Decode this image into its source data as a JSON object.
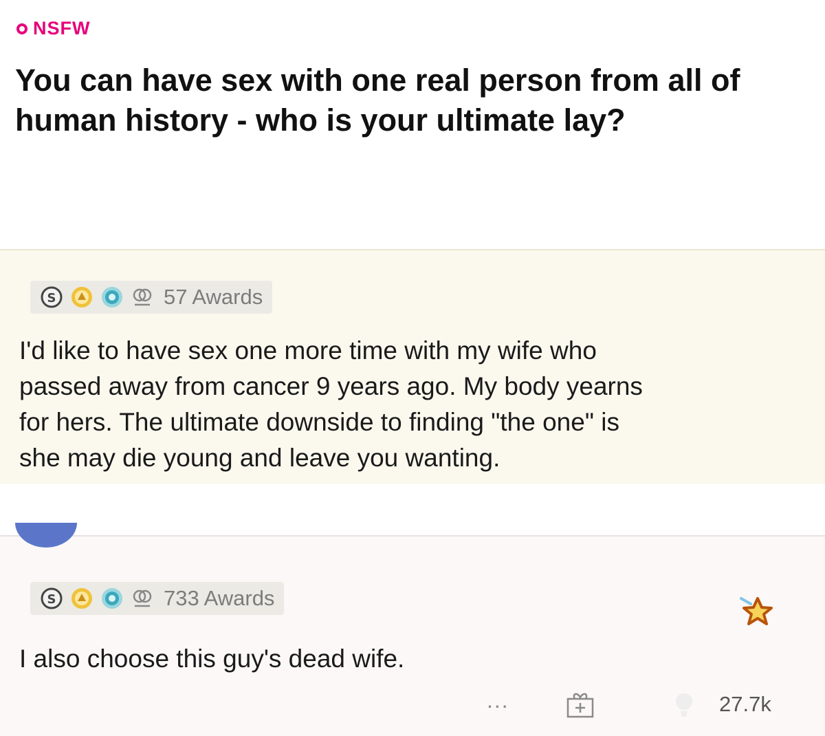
{
  "post": {
    "nsfw_label": "NSFW",
    "title": "You can have sex with one real person from all of human history - who is your ultimate lay?"
  },
  "comments": [
    {
      "awards_label": "57 Awards",
      "body_lines": [
        "I'd like to have sex one more time with my wife who",
        "passed away from cancer 9 years ago.  My body yearns",
        "for hers.  The ultimate downside to finding \"the one\" is",
        "she may die young and leave you wanting."
      ],
      "award_icons": [
        "silver-award-icon",
        "gold-award-icon",
        "platinum-award-icon",
        "wholesome-award-icon"
      ]
    },
    {
      "awards_label": "733 Awards",
      "body_lines": [
        "I also choose this guy's dead wife."
      ],
      "award_icons": [
        "silver-award-icon",
        "gold-award-icon",
        "platinum-award-icon",
        "wholesome-award-icon"
      ],
      "actions": {
        "more_label": "...",
        "vote_count": "27.7k"
      }
    }
  ],
  "colors": {
    "nsfw": "#e6007a",
    "comment1_bg": "#fbf9ee",
    "comment2_bg": "#fbf8f7",
    "avatar": "#5b76c9"
  }
}
